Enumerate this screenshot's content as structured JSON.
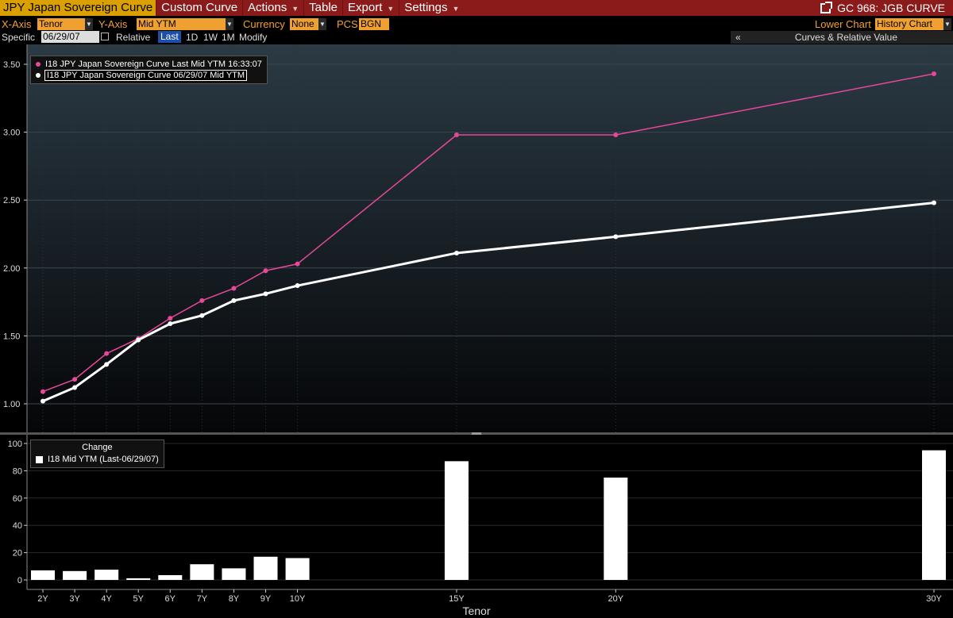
{
  "menubar": {
    "title": "JPY Japan Sovereign Curve",
    "menus": [
      "Custom Curve",
      "Actions",
      "Table",
      "Export",
      "Settings"
    ],
    "right_label": "GC 968: JGB CURVE"
  },
  "controls": {
    "xaxis_label": "X-Axis",
    "xaxis_value": "Tenor",
    "yaxis_label": "Y-Axis",
    "yaxis_value": "Mid YTM",
    "currency_label": "Currency",
    "currency_value": "None",
    "pcs_label": "PCS",
    "pcs_value": "BGN",
    "lower_chart_label": "Lower Chart",
    "lower_chart_value": "History Chart"
  },
  "row3": {
    "specific_label": "Specific",
    "specific_date": "06/29/07",
    "relative_label": "Relative",
    "last": "Last",
    "buttons": [
      "1D",
      "1W",
      "1M"
    ],
    "modify": "Modify",
    "chevron": "«",
    "panel_title": "Curves & Relative Value"
  },
  "colors": {
    "last_curve": "#e8479a",
    "hist_curve": "#ffffff",
    "bars": "#ffffff",
    "menubar": "#8b1a1a",
    "accent": "#f0a030"
  },
  "chart_data": [
    {
      "type": "line",
      "title": "",
      "xlabel": "Tenor",
      "ylabel": "",
      "x": [
        "2Y",
        "3Y",
        "4Y",
        "5Y",
        "6Y",
        "7Y",
        "8Y",
        "9Y",
        "10Y",
        "15Y",
        "20Y",
        "30Y"
      ],
      "x_years": [
        2,
        3,
        4,
        5,
        6,
        7,
        8,
        9,
        10,
        15,
        20,
        30
      ],
      "ylim": [
        0.95,
        3.6
      ],
      "yticks": [
        "1.00",
        "1.50",
        "2.00",
        "2.50",
        "3.00",
        "3.50"
      ],
      "ytick_values": [
        1.0,
        1.5,
        2.0,
        2.5,
        3.0,
        3.5
      ],
      "legend": "top-left",
      "grid": true,
      "series": [
        {
          "name": "I18 JPY Japan Sovereign Curve Last Mid YTM 16:33:07",
          "values": [
            1.09,
            1.18,
            1.37,
            1.48,
            1.63,
            1.76,
            1.85,
            1.98,
            2.03,
            2.98,
            2.98,
            3.43
          ]
        },
        {
          "name": "I18 JPY Japan Sovereign Curve 06/29/07 Mid YTM",
          "values": [
            1.02,
            1.12,
            1.29,
            1.47,
            1.59,
            1.65,
            1.76,
            1.81,
            1.87,
            2.11,
            2.23,
            2.48
          ]
        }
      ]
    },
    {
      "type": "bar",
      "title": "Change",
      "xlabel": "Tenor",
      "x": [
        "2Y",
        "3Y",
        "4Y",
        "5Y",
        "6Y",
        "7Y",
        "8Y",
        "9Y",
        "10Y",
        "15Y",
        "20Y",
        "30Y"
      ],
      "x_years": [
        2,
        3,
        4,
        5,
        6,
        7,
        8,
        9,
        10,
        15,
        20,
        30
      ],
      "ylim": [
        0,
        100
      ],
      "yticks": [
        "0",
        "20",
        "40",
        "60",
        "80",
        "100"
      ],
      "ytick_values": [
        0,
        20,
        40,
        60,
        80,
        100
      ],
      "legend": "top-left",
      "grid": true,
      "series": [
        {
          "name": "I18 Mid YTM (Last-06/29/07)",
          "values": [
            7,
            6.5,
            7.5,
            1.2,
            3.5,
            11.5,
            8.5,
            17,
            16,
            87,
            75,
            95
          ]
        }
      ]
    }
  ]
}
